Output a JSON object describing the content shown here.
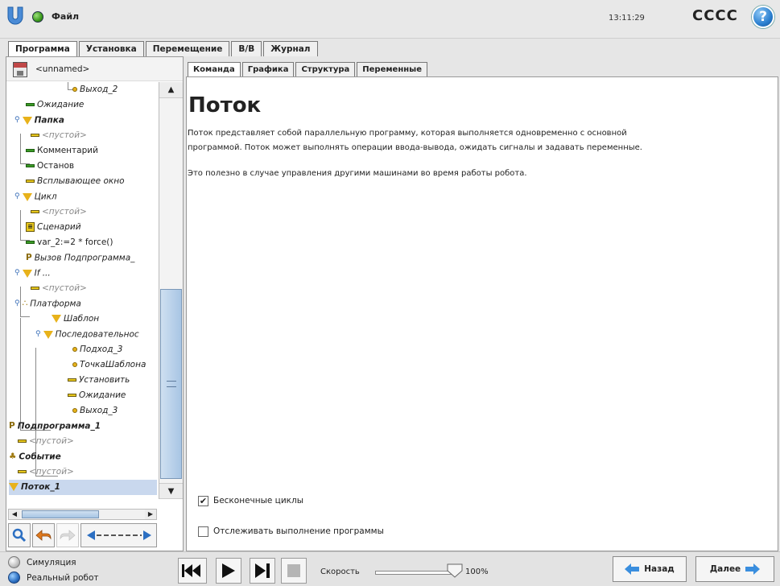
{
  "header": {
    "file_menu": "Файл",
    "clock": "13:11:29",
    "robot_name": "CCCC",
    "help_glyph": "?"
  },
  "main_tabs": [
    {
      "label": "Программа",
      "active": true
    },
    {
      "label": "Установка",
      "active": false
    },
    {
      "label": "Перемещение",
      "active": false
    },
    {
      "label": "В/В",
      "active": false
    },
    {
      "label": "Журнал",
      "active": false
    }
  ],
  "program": {
    "name": "<unnamed>"
  },
  "tree": [
    {
      "label": "Выход_2",
      "icon": "waypoint-icon"
    },
    {
      "label": "Ожидание",
      "icon": "wait-icon"
    },
    {
      "label": "Папка",
      "icon": "folder-icon"
    },
    {
      "label": "<пустой>",
      "icon": "empty-icon"
    },
    {
      "label": "Комментарий",
      "icon": "comment-icon"
    },
    {
      "label": "Останов",
      "icon": "halt-icon"
    },
    {
      "label": "Всплывающее окно",
      "icon": "popup-icon"
    },
    {
      "label": "Цикл",
      "icon": "loop-icon"
    },
    {
      "label": "<пустой>",
      "icon": "empty-icon"
    },
    {
      "label": "Сценарий",
      "icon": "script-icon"
    },
    {
      "label": "var_2:=2 * force()",
      "icon": "assignment-icon"
    },
    {
      "label": "Вызов Подпрограмма_",
      "icon": "call-icon"
    },
    {
      "label": "If ...",
      "icon": "if-icon"
    },
    {
      "label": "<пустой>",
      "icon": "empty-icon"
    },
    {
      "label": "Платформа",
      "icon": "pallet-icon"
    },
    {
      "label": "Шаблон",
      "icon": "pattern-icon"
    },
    {
      "label": "Последовательнос",
      "icon": "sequence-icon"
    },
    {
      "label": "Подход_3",
      "icon": "waypoint-icon"
    },
    {
      "label": "ТочкаШаблона",
      "icon": "waypoint-icon"
    },
    {
      "label": "Установить",
      "icon": "set-icon"
    },
    {
      "label": "Ожидание",
      "icon": "wait-icon"
    },
    {
      "label": "Выход_3",
      "icon": "waypoint-icon"
    },
    {
      "label": "Подпрограмма_1",
      "icon": "subprogram-icon"
    },
    {
      "label": "<пустой>",
      "icon": "empty-icon"
    },
    {
      "label": "Событие",
      "icon": "event-icon"
    },
    {
      "label": "<пустой>",
      "icon": "empty-icon"
    },
    {
      "label": "Поток_1",
      "icon": "thread-icon"
    }
  ],
  "sub_tabs": [
    {
      "label": "Команда",
      "active": true
    },
    {
      "label": "Графика",
      "active": false
    },
    {
      "label": "Структура",
      "active": false
    },
    {
      "label": "Переменные",
      "active": false
    }
  ],
  "content": {
    "title": "Поток",
    "para1_line1": "Поток представляет собой параллельную программу, которая выполняется одновременно с основной",
    "para1_line2": "программой. Поток может выполнять операции ввода-вывода, ожидать сигналы и задавать переменные.",
    "para2": "Это полезно в случае управления другими машинами во время работы робота.",
    "opt_infinite": {
      "label": "Бесконечные циклы",
      "checked": true,
      "mark": "✔"
    },
    "opt_track": {
      "label": "Отслеживать выполнение программы",
      "checked": false
    }
  },
  "footer": {
    "mode_sim": "Симуляция",
    "mode_real": "Реальный робот",
    "speed_label": "Скорость",
    "speed_value": "100%",
    "speed_fraction": 1.0,
    "back_label": "Назад",
    "next_label": "Далее"
  },
  "colors": {
    "accent_blue": "#3a8ede",
    "led_green": "#3b9a1c",
    "selection": "#c9d8ee"
  }
}
